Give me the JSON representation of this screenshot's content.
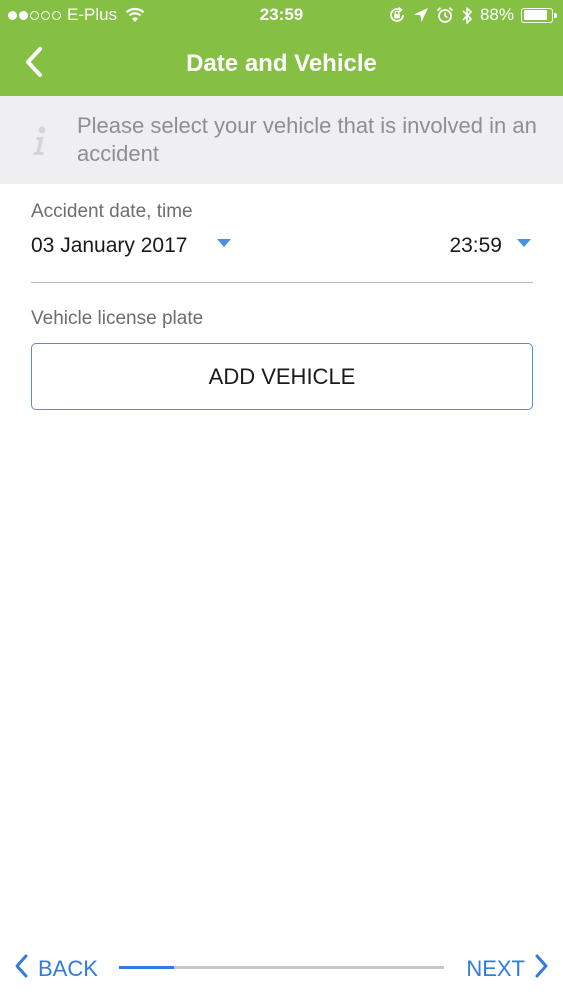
{
  "status_bar": {
    "carrier": "E-Plus",
    "time": "23:59",
    "battery_percent": "88%",
    "battery_level": 0.88,
    "signal_bars_filled": 2,
    "signal_bars_total": 5,
    "icons": [
      "wifi-icon",
      "rotation-lock-icon",
      "location-arrow-icon",
      "alarm-icon",
      "bluetooth-icon",
      "battery-icon"
    ]
  },
  "nav": {
    "title": "Date and Vehicle",
    "back_icon": "chevron-left-icon"
  },
  "info": {
    "icon": "info-icon",
    "text": "Please select your vehicle that is involved in an accident"
  },
  "form": {
    "date_label": "Accident date, time",
    "date_value": "03 January 2017",
    "time_value": "23:59",
    "vehicle_label": "Vehicle license plate",
    "add_vehicle_label": "ADD VEHICLE"
  },
  "footer": {
    "back_label": "BACK",
    "next_label": "NEXT",
    "progress": 0.17
  },
  "colors": {
    "brand_green": "#85c045",
    "accent_blue": "#2f7de1",
    "banner_gray": "#efeff1"
  }
}
